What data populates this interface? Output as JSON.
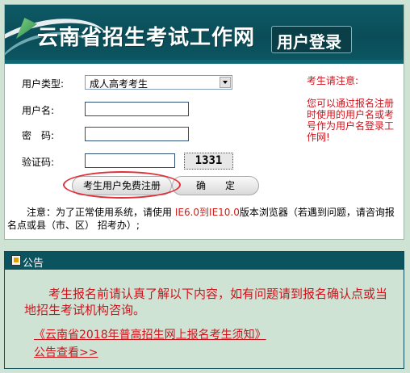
{
  "banner": {
    "site_name": "云南省招生考试工作网",
    "badge": "用户登录"
  },
  "form": {
    "user_type_label": "用户类型:",
    "user_type_value": "成人高考考生",
    "username_label": "用户名:",
    "password_label": "密　码:",
    "captcha_label": "验证码:",
    "captcha_value": "1331",
    "register_button": "考生用户免费注册",
    "confirm_button": "确　　定"
  },
  "side_notice": {
    "heading": "考生请注意:",
    "body": "您可以通过报名注册时使用的用户名或考号作为用户名登录工作网!"
  },
  "footnote": {
    "prefix": "　　注意：为了正常使用系统，请使用 ",
    "browsers": "IE6.0到IE10.0",
    "suffix": "版本浏览器（若遇到问题，请咨询报名点或县（市、区） 招考办）;"
  },
  "announcement": {
    "title": "公告",
    "body": "考生报名前请认真了解以下内容，如有问题请到报名确认点或当地招生考试机构咨询。",
    "link_text": "《云南省2018年普高招生网上报名考生须知》",
    "view_link": "公告查看>>"
  },
  "colors": {
    "banner_bg": "#0a4d58",
    "page_bg": "#cfe3d4",
    "alert_red": "#d0121b",
    "highlight_oval": "#e0303a"
  }
}
